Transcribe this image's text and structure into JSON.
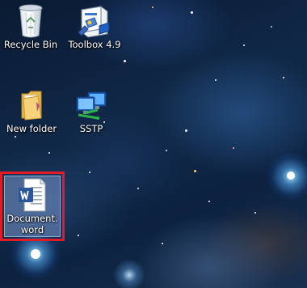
{
  "desktop": {
    "icons": [
      {
        "label": "Recycle Bin",
        "icon": "recycle-bin-icon"
      },
      {
        "label": "Toolbox 4.9",
        "icon": "toolbox-icon"
      },
      {
        "label": "New folder",
        "icon": "folder-icon"
      },
      {
        "label": "SSTP",
        "icon": "network-connection-icon"
      },
      {
        "label": "Document.word",
        "icon": "word-document-icon",
        "selected": true
      }
    ],
    "highlight_color": "#e21c26",
    "word_blue": "#2b579a"
  }
}
